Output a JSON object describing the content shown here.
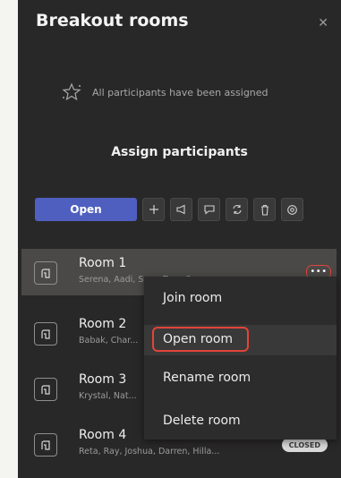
{
  "panel": {
    "title": "Breakout rooms",
    "close_icon": "close-icon",
    "assigned_status": "All participants have been assigned",
    "assign_link": "Assign participants"
  },
  "toolbar": {
    "open_label": "Open",
    "icons": [
      "add-icon",
      "announce-icon",
      "chat-icon",
      "recreate-icon",
      "delete-icon",
      "settings-icon"
    ]
  },
  "rooms": [
    {
      "name": "Room 1",
      "members": "Serena, Aadi, Sara, Tom, Ser...",
      "more_label": "•••"
    },
    {
      "name": "Room 2",
      "members": "Babak, Char..."
    },
    {
      "name": "Room 3",
      "members": "Krystal, Nat..."
    },
    {
      "name": "Room 4",
      "members": "Reta, Ray, Joshua, Darren, Hilla...",
      "status": "CLOSED"
    }
  ],
  "context_menu": {
    "items": [
      "Join room",
      "Open room",
      "Rename room",
      "Delete room"
    ]
  },
  "colors": {
    "panel_bg": "#292828",
    "accent": "#4f5fc0",
    "highlight_outline": "#e2443a"
  }
}
